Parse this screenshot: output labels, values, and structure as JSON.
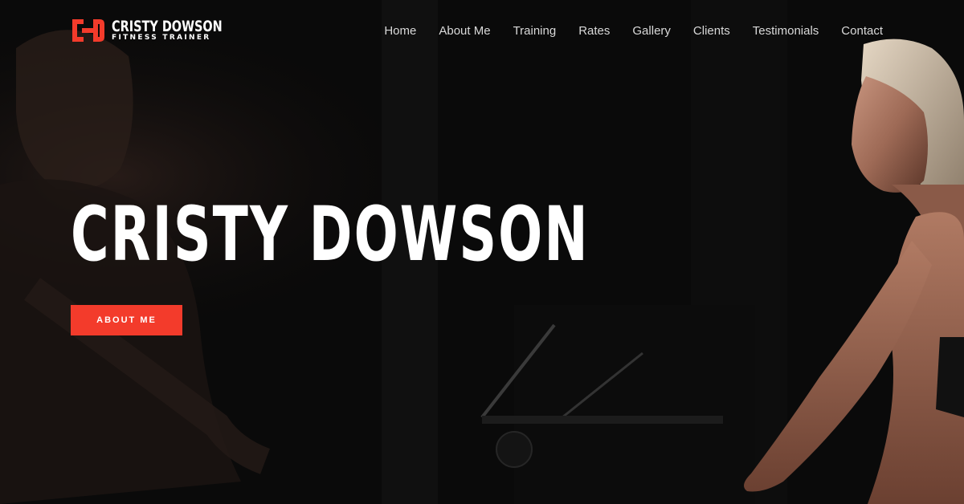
{
  "brand": {
    "name": "CRISTY DOWSON",
    "tagline": "FITNESS TRAINER",
    "monogram_icon": "cd-monogram-logo",
    "accent_color": "#f33b2b"
  },
  "nav": {
    "items": [
      {
        "label": "Home"
      },
      {
        "label": "About Me"
      },
      {
        "label": "Training"
      },
      {
        "label": "Rates"
      },
      {
        "label": "Gallery"
      },
      {
        "label": "Clients"
      },
      {
        "label": "Testimonials"
      },
      {
        "label": "Contact"
      }
    ]
  },
  "hero": {
    "title": "CRISTY DOWSON",
    "cta_label": "ABOUT ME",
    "background": "dark gym photo of women on rowing machines"
  }
}
